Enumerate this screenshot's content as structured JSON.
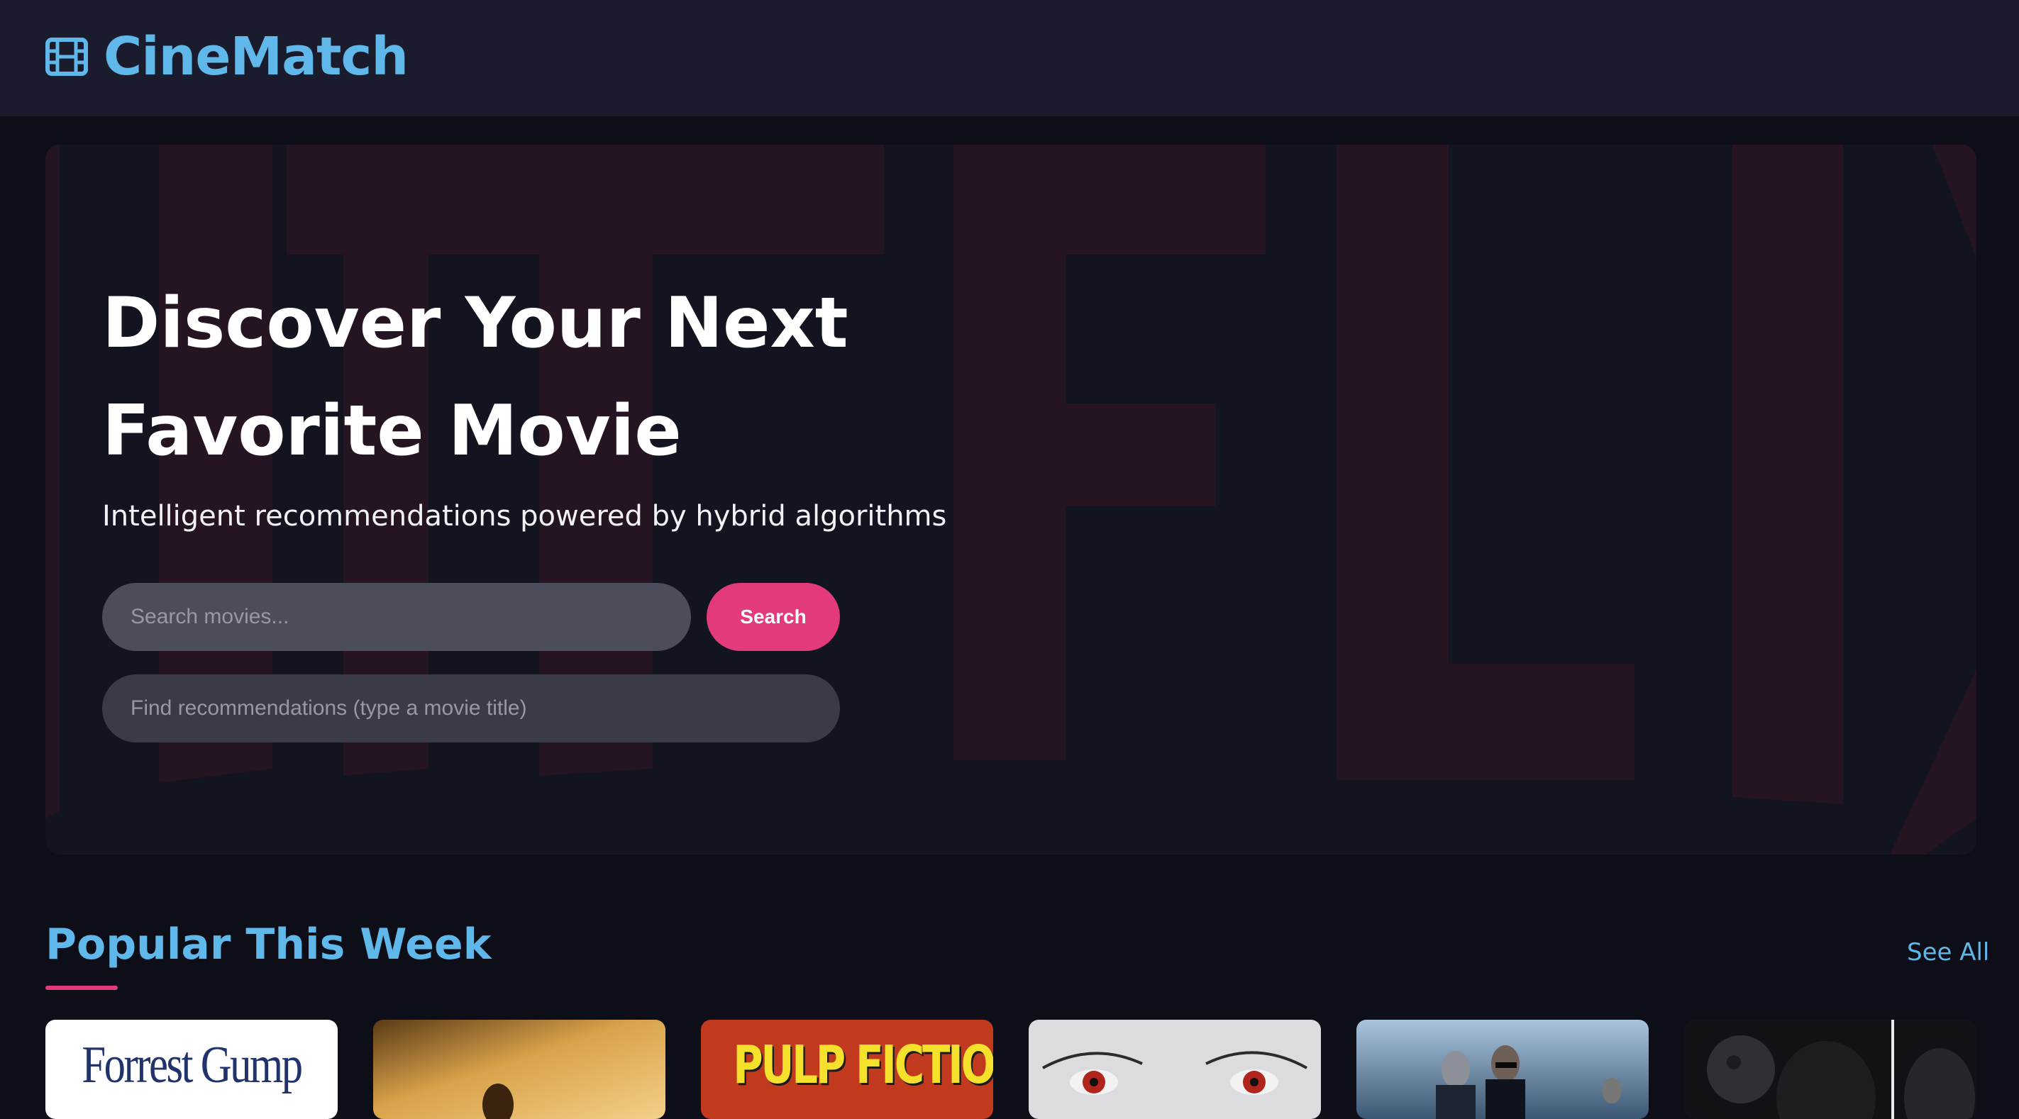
{
  "app": {
    "name": "CineMatch",
    "logo_icon": "film-icon",
    "brand_color": "#5fb8e9"
  },
  "hero": {
    "title": "Discover Your Next Favorite Movie",
    "subtitle": "Intelligent recommendations powered by hybrid algorithms",
    "search": {
      "placeholder": "Search movies...",
      "value": "",
      "button_label": "Search"
    },
    "recommend": {
      "placeholder": "Find recommendations (type a movie title)",
      "value": ""
    },
    "background_letters": "NETFLIX",
    "accent_color": "#e33a7c"
  },
  "popular": {
    "title": "Popular This Week",
    "see_all_label": "See All",
    "movies": [
      {
        "poster_text": "Forrest Gump"
      },
      {
        "poster_text": ""
      },
      {
        "poster_text": "PULP FICTION"
      },
      {
        "poster_text": ""
      },
      {
        "poster_text": ""
      },
      {
        "poster_text": ""
      }
    ]
  }
}
